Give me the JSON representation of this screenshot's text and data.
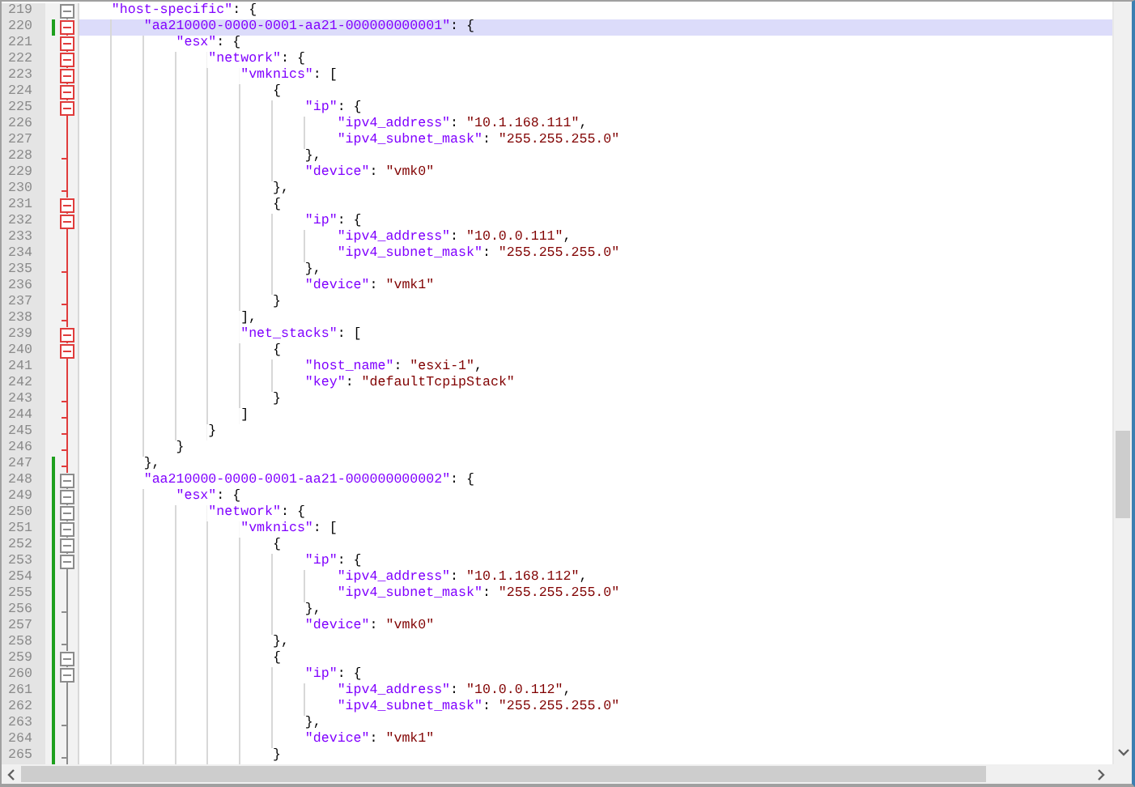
{
  "lines": [
    {
      "number": "219",
      "text": "    \"host-specific\": {",
      "kind": "open",
      "fold_active": false,
      "changed": false,
      "selected": false
    },
    {
      "number": "220",
      "text": "        \"aa210000-0000-0001-aa21-000000000001\": {",
      "kind": "open",
      "fold_active": true,
      "changed": true,
      "selected": true
    },
    {
      "number": "221",
      "text": "            \"esx\": {",
      "kind": "open",
      "fold_active": true,
      "changed": false,
      "selected": false
    },
    {
      "number": "222",
      "text": "                \"network\": {",
      "kind": "open",
      "fold_active": true,
      "changed": false,
      "selected": false
    },
    {
      "number": "223",
      "text": "                    \"vmknics\": [",
      "kind": "open",
      "fold_active": true,
      "changed": false,
      "selected": false
    },
    {
      "number": "224",
      "text": "                        {",
      "kind": "open",
      "fold_active": true,
      "changed": false,
      "selected": false
    },
    {
      "number": "225",
      "text": "                            \"ip\": {",
      "kind": "open",
      "fold_active": true,
      "changed": false,
      "selected": false
    },
    {
      "number": "226",
      "text": "                                \"ipv4_address\": \"10.1.168.111\",",
      "kind": "line",
      "fold_active": true,
      "changed": false,
      "selected": false
    },
    {
      "number": "227",
      "text": "                                \"ipv4_subnet_mask\": \"255.255.255.0\"",
      "kind": "line",
      "fold_active": true,
      "changed": false,
      "selected": false
    },
    {
      "number": "228",
      "text": "                            },",
      "kind": "end",
      "fold_active": true,
      "changed": false,
      "selected": false
    },
    {
      "number": "229",
      "text": "                            \"device\": \"vmk0\"",
      "kind": "line",
      "fold_active": true,
      "changed": false,
      "selected": false
    },
    {
      "number": "230",
      "text": "                        },",
      "kind": "end",
      "fold_active": true,
      "changed": false,
      "selected": false
    },
    {
      "number": "231",
      "text": "                        {",
      "kind": "open",
      "fold_active": true,
      "changed": false,
      "selected": false
    },
    {
      "number": "232",
      "text": "                            \"ip\": {",
      "kind": "open",
      "fold_active": true,
      "changed": false,
      "selected": false
    },
    {
      "number": "233",
      "text": "                                \"ipv4_address\": \"10.0.0.111\",",
      "kind": "line",
      "fold_active": true,
      "changed": false,
      "selected": false
    },
    {
      "number": "234",
      "text": "                                \"ipv4_subnet_mask\": \"255.255.255.0\"",
      "kind": "line",
      "fold_active": true,
      "changed": false,
      "selected": false
    },
    {
      "number": "235",
      "text": "                            },",
      "kind": "end",
      "fold_active": true,
      "changed": false,
      "selected": false
    },
    {
      "number": "236",
      "text": "                            \"device\": \"vmk1\"",
      "kind": "line",
      "fold_active": true,
      "changed": false,
      "selected": false
    },
    {
      "number": "237",
      "text": "                        }",
      "kind": "end",
      "fold_active": true,
      "changed": false,
      "selected": false
    },
    {
      "number": "238",
      "text": "                    ],",
      "kind": "end",
      "fold_active": true,
      "changed": false,
      "selected": false
    },
    {
      "number": "239",
      "text": "                    \"net_stacks\": [",
      "kind": "open",
      "fold_active": true,
      "changed": false,
      "selected": false
    },
    {
      "number": "240",
      "text": "                        {",
      "kind": "open",
      "fold_active": true,
      "changed": false,
      "selected": false
    },
    {
      "number": "241",
      "text": "                            \"host_name\": \"esxi-1\",",
      "kind": "line",
      "fold_active": true,
      "changed": false,
      "selected": false
    },
    {
      "number": "242",
      "text": "                            \"key\": \"defaultTcpipStack\"",
      "kind": "line",
      "fold_active": true,
      "changed": false,
      "selected": false
    },
    {
      "number": "243",
      "text": "                        }",
      "kind": "end",
      "fold_active": true,
      "changed": false,
      "selected": false
    },
    {
      "number": "244",
      "text": "                    ]",
      "kind": "end",
      "fold_active": true,
      "changed": false,
      "selected": false
    },
    {
      "number": "245",
      "text": "                }",
      "kind": "end",
      "fold_active": true,
      "changed": false,
      "selected": false
    },
    {
      "number": "246",
      "text": "            }",
      "kind": "end",
      "fold_active": true,
      "changed": false,
      "selected": false
    },
    {
      "number": "247",
      "text": "        },",
      "kind": "end",
      "fold_active": true,
      "changed": true,
      "selected": false
    },
    {
      "number": "248",
      "text": "        \"aa210000-0000-0001-aa21-000000000002\": {",
      "kind": "open",
      "fold_active": false,
      "changed": true,
      "selected": false
    },
    {
      "number": "249",
      "text": "            \"esx\": {",
      "kind": "open",
      "fold_active": false,
      "changed": true,
      "selected": false
    },
    {
      "number": "250",
      "text": "                \"network\": {",
      "kind": "open",
      "fold_active": false,
      "changed": true,
      "selected": false
    },
    {
      "number": "251",
      "text": "                    \"vmknics\": [",
      "kind": "open",
      "fold_active": false,
      "changed": true,
      "selected": false
    },
    {
      "number": "252",
      "text": "                        {",
      "kind": "open",
      "fold_active": false,
      "changed": true,
      "selected": false
    },
    {
      "number": "253",
      "text": "                            \"ip\": {",
      "kind": "open",
      "fold_active": false,
      "changed": true,
      "selected": false
    },
    {
      "number": "254",
      "text": "                                \"ipv4_address\": \"10.1.168.112\",",
      "kind": "line",
      "fold_active": false,
      "changed": true,
      "selected": false
    },
    {
      "number": "255",
      "text": "                                \"ipv4_subnet_mask\": \"255.255.255.0\"",
      "kind": "line",
      "fold_active": false,
      "changed": true,
      "selected": false
    },
    {
      "number": "256",
      "text": "                            },",
      "kind": "end",
      "fold_active": false,
      "changed": true,
      "selected": false
    },
    {
      "number": "257",
      "text": "                            \"device\": \"vmk0\"",
      "kind": "line",
      "fold_active": false,
      "changed": true,
      "selected": false
    },
    {
      "number": "258",
      "text": "                        },",
      "kind": "end",
      "fold_active": false,
      "changed": true,
      "selected": false
    },
    {
      "number": "259",
      "text": "                        {",
      "kind": "open",
      "fold_active": false,
      "changed": true,
      "selected": false
    },
    {
      "number": "260",
      "text": "                            \"ip\": {",
      "kind": "open",
      "fold_active": false,
      "changed": true,
      "selected": false
    },
    {
      "number": "261",
      "text": "                                \"ipv4_address\": \"10.0.0.112\",",
      "kind": "line",
      "fold_active": false,
      "changed": true,
      "selected": false
    },
    {
      "number": "262",
      "text": "                                \"ipv4_subnet_mask\": \"255.255.255.0\"",
      "kind": "line",
      "fold_active": false,
      "changed": true,
      "selected": false
    },
    {
      "number": "263",
      "text": "                            },",
      "kind": "end",
      "fold_active": false,
      "changed": true,
      "selected": false
    },
    {
      "number": "264",
      "text": "                            \"device\": \"vmk1\"",
      "kind": "line",
      "fold_active": false,
      "changed": true,
      "selected": false
    },
    {
      "number": "265",
      "text": "                        }",
      "kind": "end",
      "fold_active": false,
      "changed": true,
      "selected": false
    }
  ]
}
